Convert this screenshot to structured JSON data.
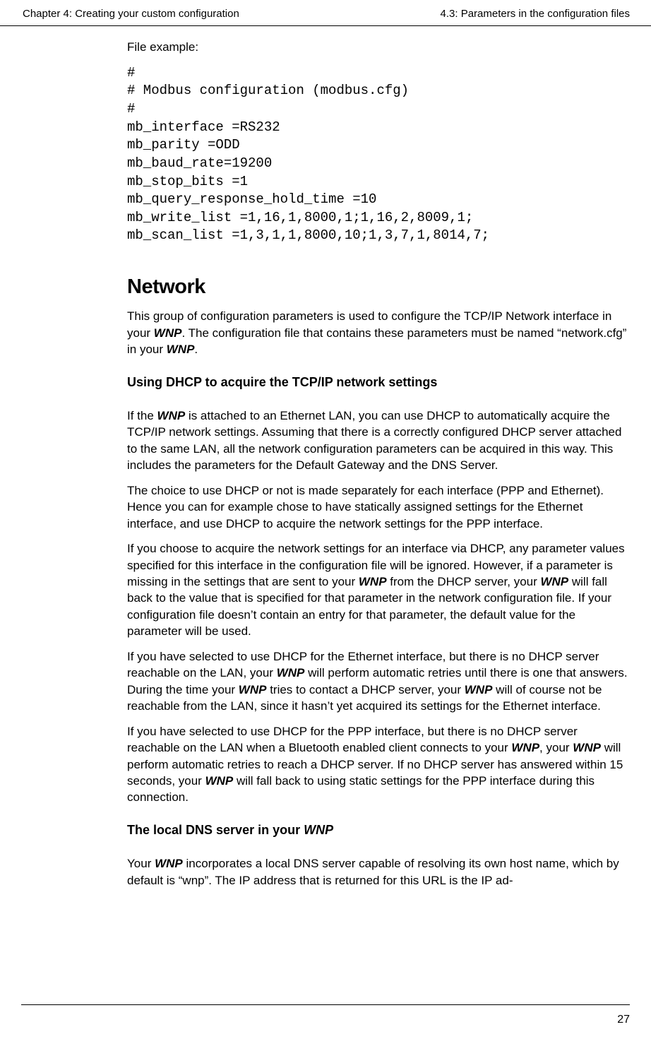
{
  "header": {
    "left": "Chapter 4: Creating your custom configuration",
    "right": "4.3: Parameters in the configuration files"
  },
  "intro_label": "File example:",
  "code": "#\n# Modbus configuration (modbus.cfg)\n#\nmb_interface =RS232\nmb_parity =ODD\nmb_baud_rate=19200\nmb_stop_bits =1\nmb_query_response_hold_time =10\nmb_write_list =1,16,1,8000,1;1,16,2,8009,1;\nmb_scan_list =1,3,1,1,8000,10;1,3,7,1,8014,7;",
  "section": {
    "heading": "Network",
    "para1_a": "This group of configuration parameters is used to configure the TCP/IP Network interface in your ",
    "para1_b": ". The configuration file that contains these parameters must be named “network.cfg” in your ",
    "para1_c": ".",
    "sub1": "Using DHCP to acquire the TCP/IP network settings",
    "p2_a": "If the ",
    "p2_b": " is attached to an Ethernet LAN, you can use DHCP to automatically acquire the TCP/IP network settings. Assuming that there is a correctly configured DHCP server attached to the same LAN, all the network configuration parameters can be acquired in this way. This includes the parameters for the Default Gateway and the DNS Server.",
    "p3": "The choice to use DHCP or not is made separately for each interface (PPP and Ethernet). Hence you can for example chose to have statically assigned settings for the Ethernet interface, and use DHCP to acquire the network settings for the PPP interface.",
    "p4_a": "If you choose to acquire the network settings for an interface via DHCP, any parameter values specified for this interface in the configuration file will be ignored. However, if a parameter is missing in the settings that are sent to your ",
    "p4_b": " from the DHCP server, your ",
    "p4_c": " will fall back to the value that is specified for that parameter in the network configuration file. If your configuration file doesn’t contain an entry for that parameter, the default value for the parameter will be used.",
    "p5_a": "If you have selected to use DHCP for the Ethernet interface, but there is no DHCP server reachable on the LAN, your ",
    "p5_b": " will perform automatic retries until there is one that answers. During the time your ",
    "p5_c": " tries to contact a DHCP server, your ",
    "p5_d": " will of course not be reachable from the LAN, since it hasn’t yet acquired its settings for the Ethernet interface.",
    "p6_a": "If you have selected to use DHCP for the PPP interface, but there is no DHCP server reachable on the LAN when a Bluetooth enabled client connects to your ",
    "p6_b": ", your ",
    "p6_c": " will perform automatic retries to reach a DHCP server. If no DHCP server has answered within 15 seconds, your ",
    "p6_d": " will fall back to using static settings for the PPP interface during this connection.",
    "sub2_a": "The local DNS server in your ",
    "p7_a": "Your ",
    "p7_b": " incorporates a local DNS server capable of resolving its own host name, which by default is “wnp”. The IP address that is returned for this URL is the IP ad-"
  },
  "wnp": "WNP",
  "page_number": "27"
}
